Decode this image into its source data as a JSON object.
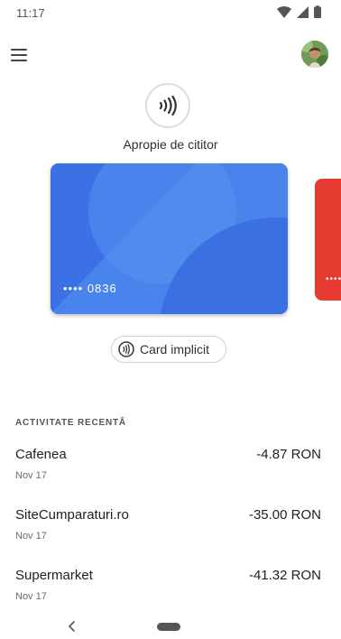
{
  "status_bar": {
    "time": "11:17",
    "icons": [
      "wifi-icon",
      "cell-signal-icon",
      "battery-icon"
    ]
  },
  "header": {
    "menu_icon": "menu-icon",
    "avatar": "profile-avatar"
  },
  "nfc": {
    "icon": "contactless-icon",
    "label": "Apropie de cititor"
  },
  "cards": {
    "main": {
      "masked_number": "•••• 0836",
      "color": "#3c71e6"
    },
    "next": {
      "masked_number": "••••",
      "color": "#e53a2f"
    }
  },
  "default_chip": {
    "icon": "contactless-icon",
    "label": "Card implicit"
  },
  "activity": {
    "header": "ACTIVITATE RECENTĂ",
    "transactions": [
      {
        "merchant": "Cafenea",
        "date": "Nov 17",
        "amount": "-4.87 RON"
      },
      {
        "merchant": "SiteCumparaturi.ro",
        "date": "Nov 17",
        "amount": "-35.00 RON"
      },
      {
        "merchant": "Supermarket",
        "date": "Nov 17",
        "amount": "-41.32 RON"
      }
    ]
  },
  "navigation": {
    "back_icon": "back-icon",
    "home_icon": "home-pill-icon"
  }
}
